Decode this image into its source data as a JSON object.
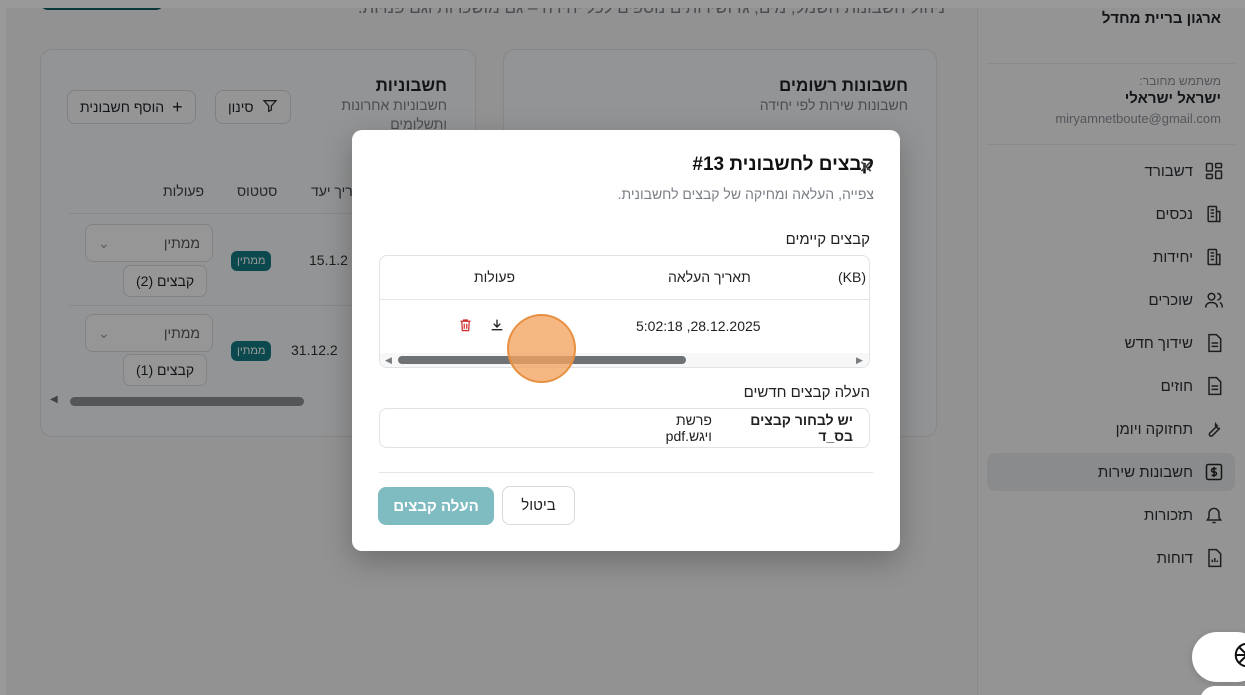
{
  "sidebar": {
    "org_name": "ארגון בריית מחדל",
    "user_caption": "משתמש מחובר:",
    "user_name": "ישראל ישראלי",
    "user_email": "miryamnetboute@gmail.com",
    "items": [
      {
        "label": "דשבורד",
        "icon": "dashboard-icon"
      },
      {
        "label": "נכסים",
        "icon": "building-icon"
      },
      {
        "label": "יחידות",
        "icon": "building-icon"
      },
      {
        "label": "שוכרים",
        "icon": "users-icon"
      },
      {
        "label": "שידוך חדש",
        "icon": "document-icon"
      },
      {
        "label": "חוזים",
        "icon": "document-icon"
      },
      {
        "label": "תחזוקה ויומן",
        "icon": "wrench-icon"
      },
      {
        "label": "חשבונות שירות",
        "icon": "dollar-icon",
        "active": true
      },
      {
        "label": "תזכורות",
        "icon": "bell-icon"
      },
      {
        "label": "דוחות",
        "icon": "report-icon"
      }
    ]
  },
  "main": {
    "subtitle": "ניהול חשבונות חשמל, מים, גז ושירותים נוספים לכל יחידה – גם מושכרות וגם פנויות.",
    "registered_card": {
      "title": "חשבונות רשומים",
      "subtitle": "חשבונות שירות לפי יחידה"
    },
    "bills_card": {
      "title": "חשבוניות",
      "subtitle": "חשבוניות אחרונות ותשלומים",
      "filter_label": "סינון",
      "add_label": "הוסף חשבונית",
      "headers": {
        "actions": "פעולות",
        "status": "סטטוס",
        "due": "ריך יעד"
      },
      "rows": [
        {
          "dropdown": "ממתין",
          "files": "קבצים (2)",
          "badge": "ממתין",
          "date": "15.1.2"
        },
        {
          "dropdown": "ממתין",
          "files": "קבצים (1)",
          "badge": "ממתין",
          "date": "31.12.2"
        }
      ]
    }
  },
  "dialog": {
    "title": "קבצים לחשבונית #13",
    "description": "צפייה, העלאה ומחיקה של קבצים לחשבונית.",
    "existing_label": "קבצים קיימים",
    "table_headers": {
      "size": "(KB)",
      "uploaded": "תאריך העלאה",
      "actions": "פעולות"
    },
    "files": [
      {
        "uploaded": "5:02:18 ,28.12.2025"
      }
    ],
    "upload_label": "העלה קבצים חדשים",
    "file_input_button": "יש לבחור קבצים בס_ד",
    "file_input_value": "פרשת ויגש.pdf",
    "cancel_label": "ביטול",
    "upload_button": "העלה קבצים"
  }
}
